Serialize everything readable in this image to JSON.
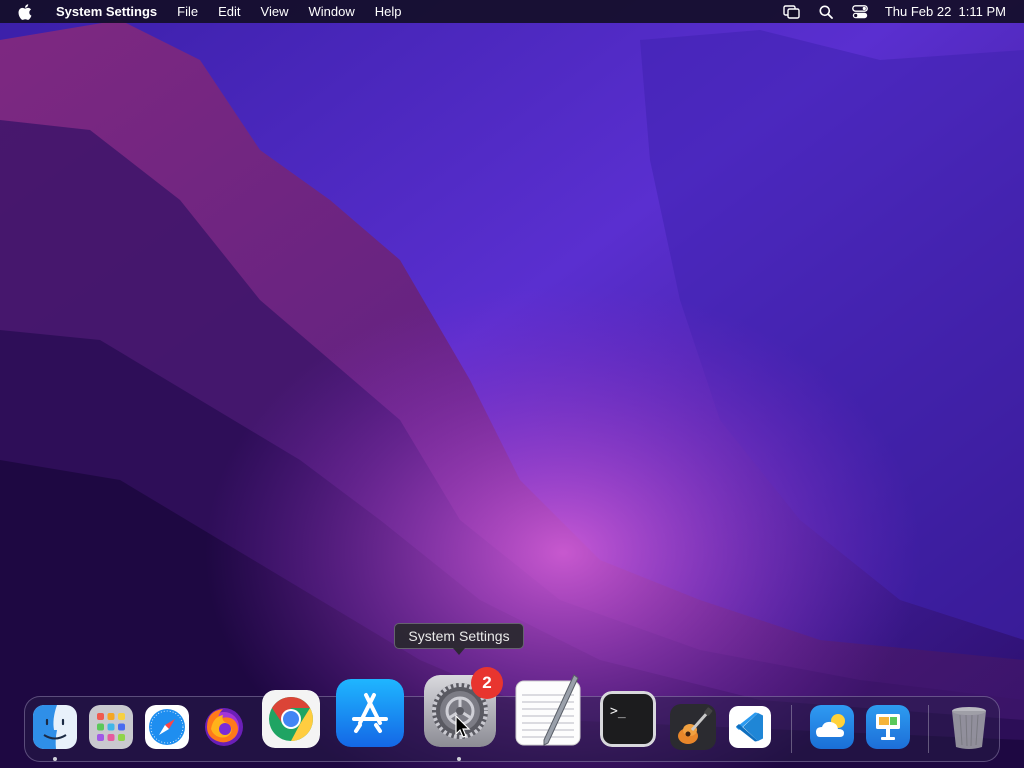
{
  "menubar": {
    "app_name": "System Settings",
    "menus": [
      "File",
      "Edit",
      "View",
      "Window",
      "Help"
    ],
    "clock": "Thu Feb 22  1:11 PM"
  },
  "tooltip": {
    "text": "System Settings"
  },
  "dock": {
    "apps": [
      {
        "name": "Finder",
        "icon": "finder-icon",
        "running": true
      },
      {
        "name": "Launchpad",
        "icon": "launchpad-icon",
        "running": false
      },
      {
        "name": "Safari",
        "icon": "safari-icon",
        "running": false
      },
      {
        "name": "Firefox",
        "icon": "firefox-icon",
        "running": false
      },
      {
        "name": "Google Chrome",
        "icon": "chrome-icon",
        "running": false
      },
      {
        "name": "App Store",
        "icon": "app-store-icon",
        "running": false
      },
      {
        "name": "System Settings",
        "icon": "system-settings-icon",
        "running": true,
        "badge": "2"
      },
      {
        "name": "TextEdit",
        "icon": "textedit-icon",
        "running": false
      },
      {
        "name": "Terminal",
        "icon": "terminal-icon",
        "running": false
      },
      {
        "name": "GarageBand",
        "icon": "garageband-icon",
        "running": false
      },
      {
        "name": "Visual Studio Code",
        "icon": "vscode-icon",
        "running": false
      },
      {
        "name": "Weather",
        "icon": "weather-icon",
        "running": false
      },
      {
        "name": "Keynote",
        "icon": "keynote-icon",
        "running": false
      },
      {
        "name": "Trash",
        "icon": "trash-icon",
        "running": false
      }
    ],
    "terminal_prompt": ">_"
  },
  "colors": {
    "badge": "#e8352f",
    "menubar": "#140e28"
  }
}
